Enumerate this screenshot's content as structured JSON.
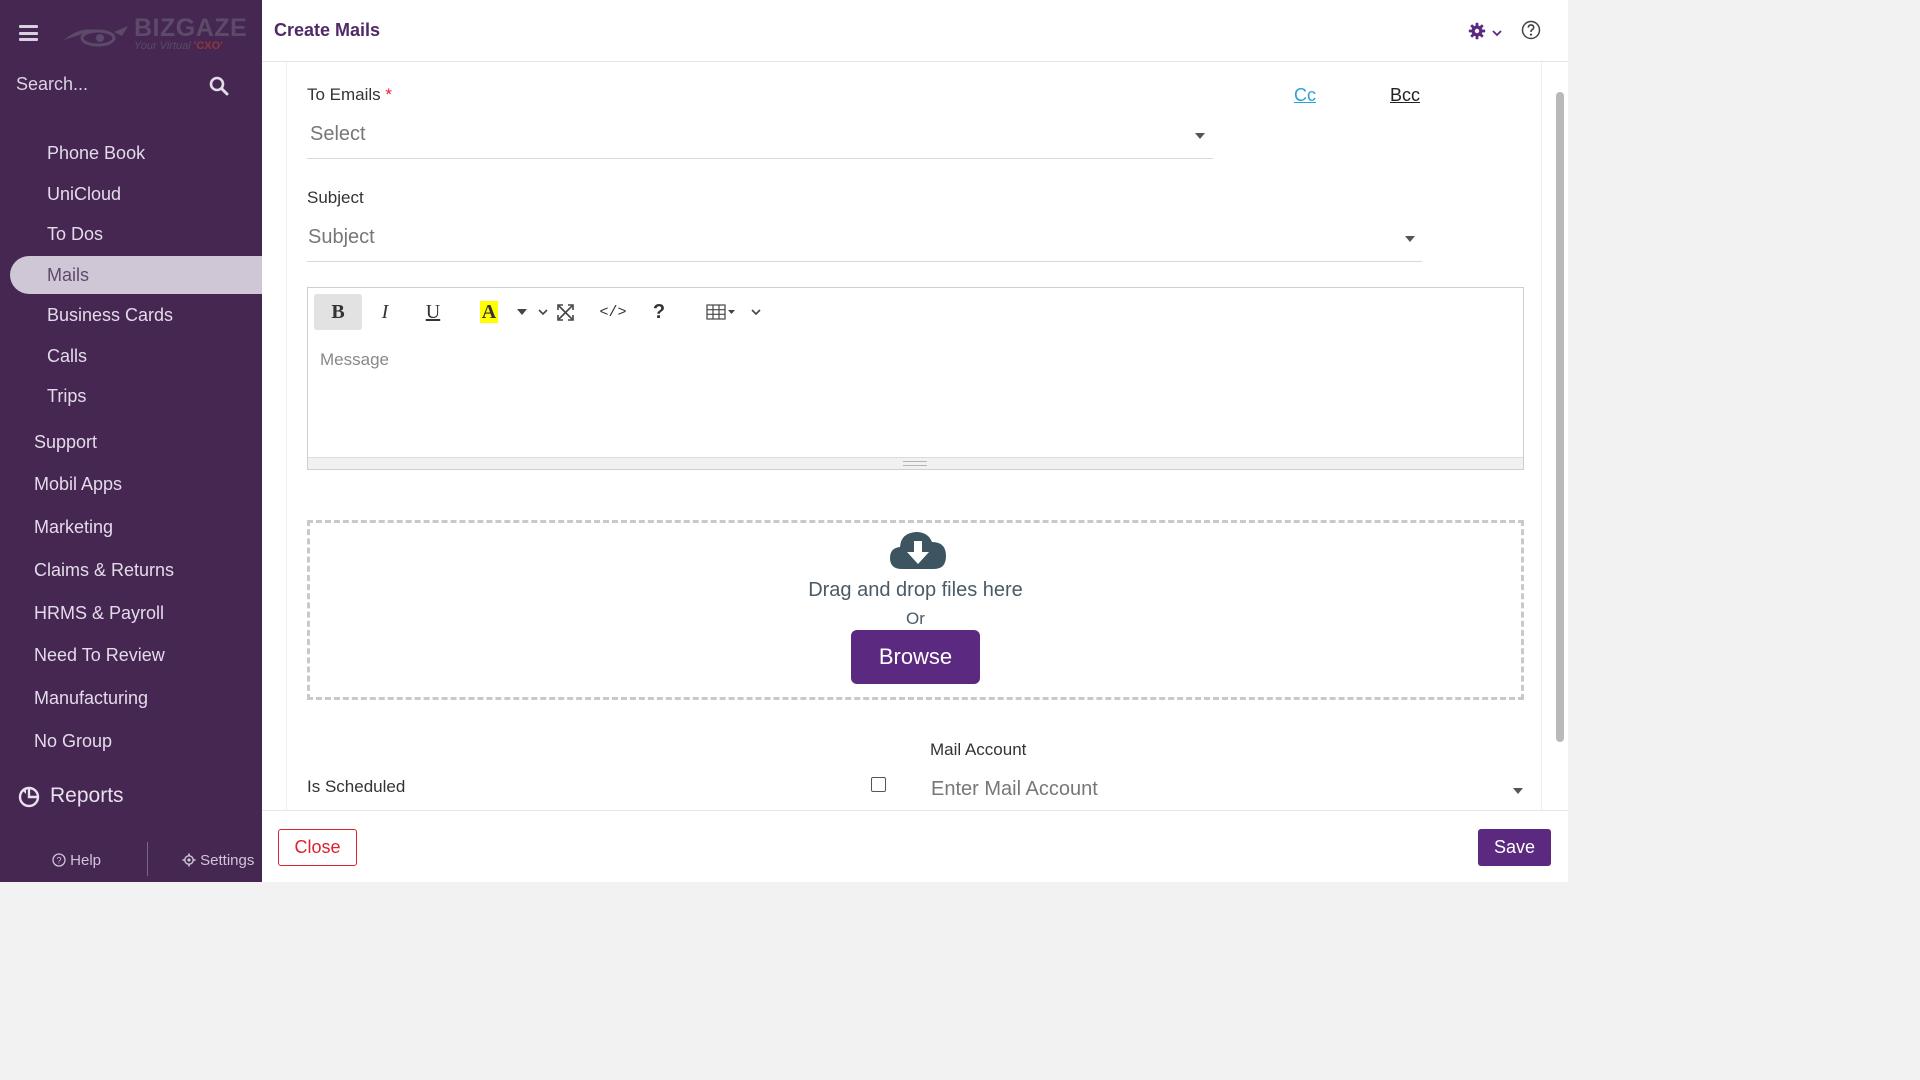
{
  "app": {
    "logo_text": "BIZGAZE",
    "logo_tagline_prefix": "Your Virtual ",
    "logo_tagline_highlight": "'CXO'"
  },
  "sidebar": {
    "search_placeholder": "Search...",
    "items": [
      {
        "label": "Phone Book",
        "active": false
      },
      {
        "label": "UniCloud",
        "active": false
      },
      {
        "label": "To Dos",
        "active": false
      },
      {
        "label": "Mails",
        "active": true
      },
      {
        "label": "Business Cards",
        "active": false
      },
      {
        "label": "Calls",
        "active": false
      },
      {
        "label": "Trips",
        "active": false
      }
    ],
    "groups": [
      "Support",
      "Mobil Apps",
      "Marketing",
      "Claims & Returns",
      "HRMS & Payroll",
      "Need To Review",
      "Manufacturing",
      "No Group"
    ],
    "reports_label": "Reports",
    "help_label": "Help",
    "settings_label": "Settings"
  },
  "header": {
    "title": "Create Mails"
  },
  "form": {
    "to_emails_label": "To Emails",
    "required_mark": "*",
    "to_emails_placeholder": "Select",
    "cc_label": "Cc",
    "bcc_label": "Bcc",
    "subject_label": "Subject",
    "subject_placeholder": "Subject",
    "message_placeholder": "Message",
    "dropzone_text": "Drag and drop files here",
    "dropzone_or": "Or",
    "browse_label": "Browse",
    "is_scheduled_label": "Is Scheduled",
    "is_scheduled_checked": false,
    "mail_account_label": "Mail Account",
    "mail_account_placeholder": "Enter Mail Account"
  },
  "footer": {
    "close_label": "Close",
    "save_label": "Save"
  },
  "colors": {
    "sidebar_bg": "#452752",
    "accent": "#5b2a80",
    "title": "#4f2a68",
    "danger": "#e0212f",
    "link": "#2aa2d8"
  }
}
